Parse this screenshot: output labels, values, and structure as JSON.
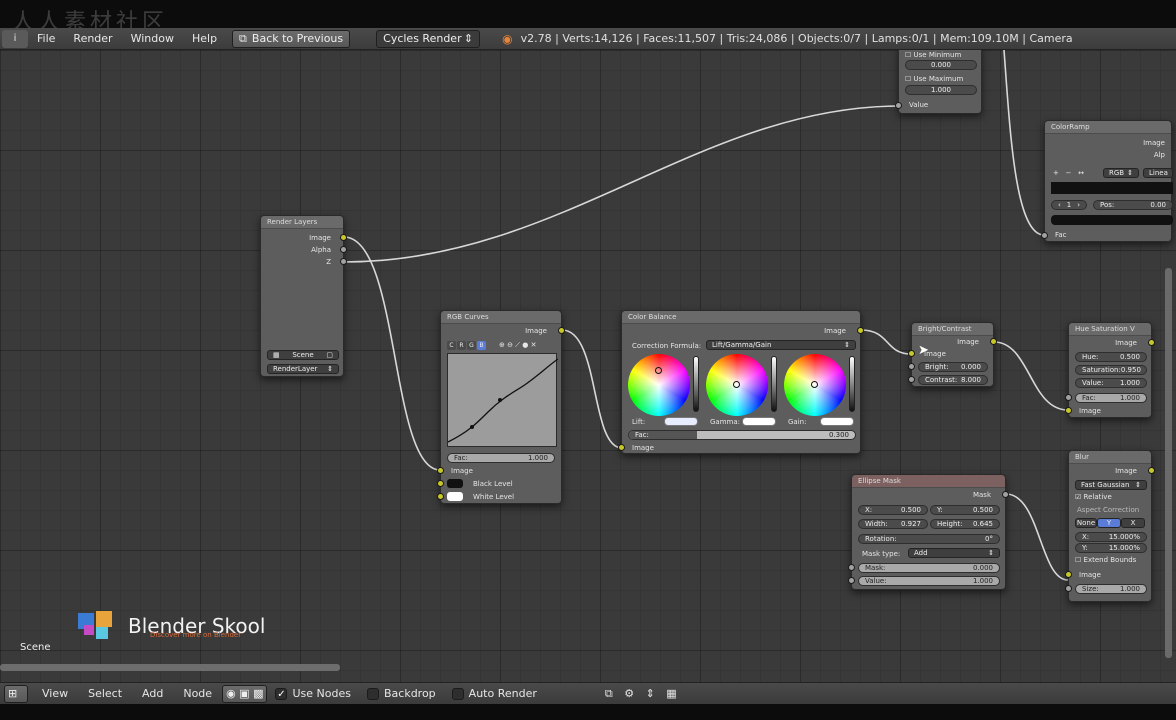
{
  "watermark": "人人素材社区",
  "menubar": {
    "editor_icon": "i",
    "menus": [
      "File",
      "Render",
      "Window",
      "Help"
    ],
    "back_button": "Back to Previous",
    "render_engine": "Cycles Render",
    "stats": "v2.78 | Verts:14,126 | Faces:11,507 | Tris:24,086 | Objects:0/7 | Lamps:0/1 | Mem:109.10M | Camera"
  },
  "nodes": {
    "render_layers": {
      "title": "Render Layers",
      "outputs": [
        "Image",
        "Alpha",
        "Z"
      ],
      "scene": "Scene",
      "layer": "RenderLayer"
    },
    "rgb_curves": {
      "title": "RGB Curves",
      "channels": [
        "C",
        "R",
        "G",
        "B"
      ],
      "output": "Image",
      "fac_label": "Fac:",
      "fac_value": "1.000",
      "inputs": [
        "Image",
        "Black Level",
        "White Level"
      ]
    },
    "color_balance": {
      "title": "Color Balance",
      "output": "Image",
      "formula_label": "Correction Formula:",
      "formula_value": "Lift/Gamma/Gain",
      "wheels": [
        "Lift:",
        "Gamma:",
        "Gain:"
      ],
      "fac_label": "Fac:",
      "fac_value": "0.300",
      "fac_fraction": 0.3,
      "input": "Image"
    },
    "bright_contrast": {
      "title": "Bright/Contrast",
      "output": "Image",
      "input": "Image",
      "bright_label": "Bright:",
      "bright_value": "0.000",
      "contrast_label": "Contrast:",
      "contrast_value": "8.000"
    },
    "hue_saturation": {
      "title": "Hue Saturation V",
      "output": "Image",
      "fields": [
        {
          "label": "Hue:",
          "value": "0.500"
        },
        {
          "label": "Saturation:",
          "value": "0.950"
        },
        {
          "label": "Value:",
          "value": "1.000"
        },
        {
          "label": "Fac:",
          "value": "1.000"
        }
      ],
      "input": "Image"
    },
    "ellipse_mask": {
      "title": "Ellipse Mask",
      "output": "Mask",
      "x_label": "X:",
      "x_value": "0.500",
      "y_label": "Y:",
      "y_value": "0.500",
      "width_label": "Width:",
      "width_value": "0.927",
      "height_label": "Height:",
      "height_value": "0.645",
      "rotation_label": "Rotation:",
      "rotation_value": "0°",
      "mask_type_label": "Mask type:",
      "mask_type_value": "Add",
      "mask_label": "Mask:",
      "mask_value": "0.000",
      "value_label": "Value:",
      "value_value": "1.000"
    },
    "blur": {
      "title": "Blur",
      "output": "Image",
      "filter": "Fast Gaussian",
      "relative": "Relative",
      "aspect_label": "Aspect Correction",
      "aspect_options": [
        "None",
        "Y",
        "X"
      ],
      "x_label": "X:",
      "x_value": "15.000%",
      "y_label": "Y:",
      "y_value": "15.000%",
      "extend": "Extend Bounds",
      "input": "Image",
      "size_label": "Size:",
      "size_value": "1.000"
    },
    "math_top": {
      "use_minimum": "Use Minimum",
      "min_value": "0.000",
      "use_maximum": "Use Maximum",
      "max_value": "1.000",
      "input": "Value"
    },
    "colorramp": {
      "title": "ColorRamp",
      "outputs": [
        "Image",
        "Alp"
      ],
      "mode": "RGB",
      "interp": "Linea",
      "index": "1",
      "pos_label": "Pos:",
      "pos_value": "0.00",
      "input": "Fac"
    }
  },
  "branding": {
    "title": "Blender Skool",
    "subtitle": "Discover more on Blender",
    "colors": [
      "#e8a33a",
      "#3a7bd5",
      "#c44bc4",
      "#5ac8e0"
    ]
  },
  "scene_label": "Scene",
  "footer": {
    "menus": [
      "View",
      "Select",
      "Add",
      "Node"
    ],
    "use_nodes": "Use Nodes",
    "backdrop": "Backdrop",
    "auto_render": "Auto Render"
  },
  "colors": {
    "socket_yellow": "#c7c729",
    "socket_grey": "#a1a1a1",
    "link": "#d8d8d8"
  }
}
